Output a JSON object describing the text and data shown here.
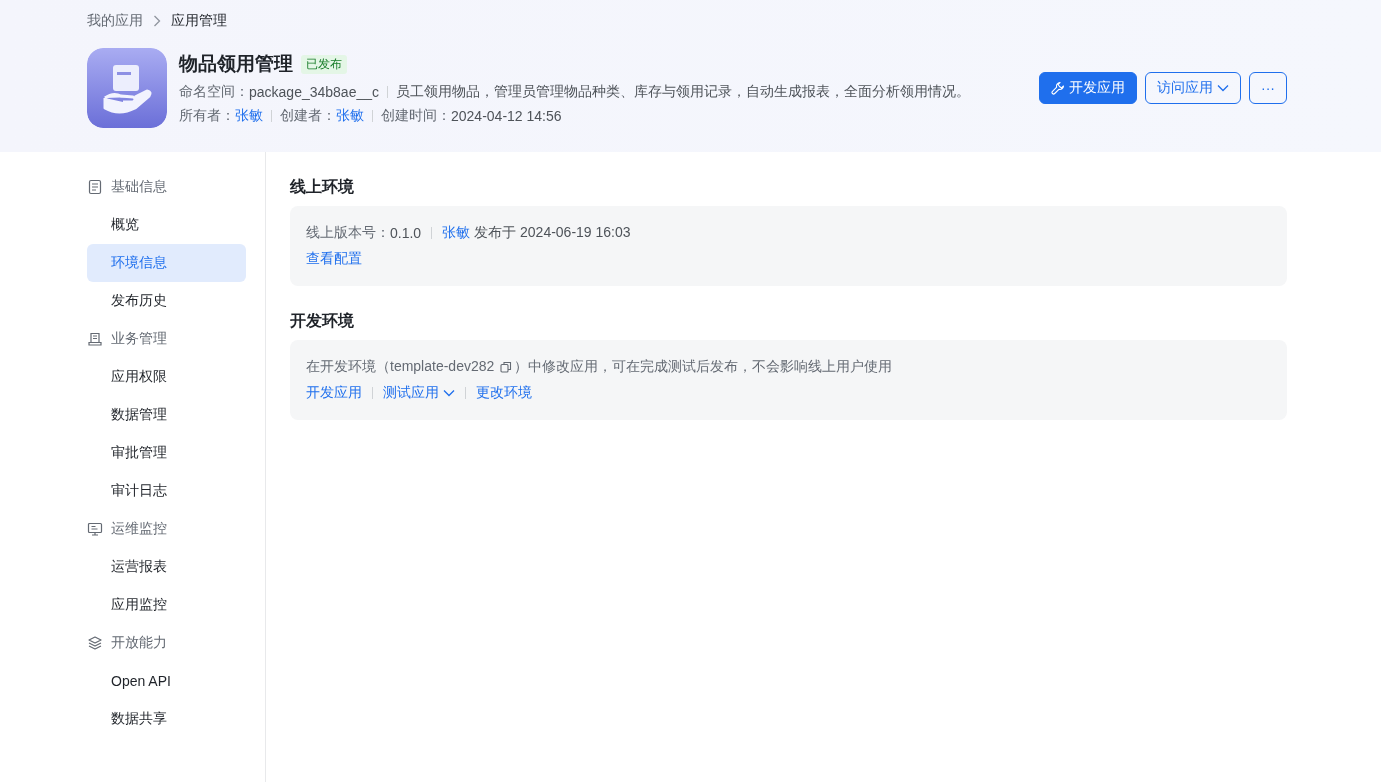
{
  "breadcrumb": [
    "我的应用",
    "应用管理"
  ],
  "app": {
    "name": "物品领用管理",
    "status": "已发布",
    "namespace_label": "命名空间：",
    "namespace": "package_34b8ae__c",
    "description": "员工领用物品，管理员管理物品种类、库存与领用记录，自动生成报表，全面分析领用情况。",
    "owner_label": "所有者：",
    "owner": "张敏",
    "creator_label": "创建者：",
    "creator": "张敏",
    "created_label": "创建时间：",
    "created": "2024-04-12 14:56"
  },
  "actions": {
    "primary": "开发应用",
    "secondary": "访问应用",
    "more": "···"
  },
  "sidebar": {
    "groups": [
      {
        "title": "基础信息",
        "items": [
          {
            "label": "概览",
            "selected": false
          },
          {
            "label": "环境信息",
            "selected": true
          },
          {
            "label": "发布历史",
            "selected": false
          }
        ]
      },
      {
        "title": "业务管理",
        "items": [
          {
            "label": "应用权限",
            "selected": false
          },
          {
            "label": "数据管理",
            "selected": false
          },
          {
            "label": "审批管理",
            "selected": false
          },
          {
            "label": "审计日志",
            "selected": false
          }
        ]
      },
      {
        "title": "运维监控",
        "items": [
          {
            "label": "运营报表",
            "selected": false
          },
          {
            "label": "应用监控",
            "selected": false
          }
        ]
      },
      {
        "title": "开放能力",
        "items": [
          {
            "label": "Open API",
            "selected": false
          },
          {
            "label": "数据共享",
            "selected": false
          }
        ]
      }
    ]
  },
  "online": {
    "title": "线上环境",
    "version_label": "线上版本号：",
    "version": "0.1.0",
    "publisher": "张敏",
    "published": "发布于 2024-06-19 16:03",
    "link": "查看配置"
  },
  "dev": {
    "title": "开发环境",
    "desc_before": "在开发环境（template-dev282",
    "desc_after": "）中修改应用，可在完成测试后发布，不会影响线上用户使用",
    "links": [
      {
        "label": "开发应用",
        "kind": "link"
      },
      {
        "label": "测试应用",
        "kind": "dropdown"
      },
      {
        "label": "更改环境",
        "kind": "link"
      }
    ]
  }
}
